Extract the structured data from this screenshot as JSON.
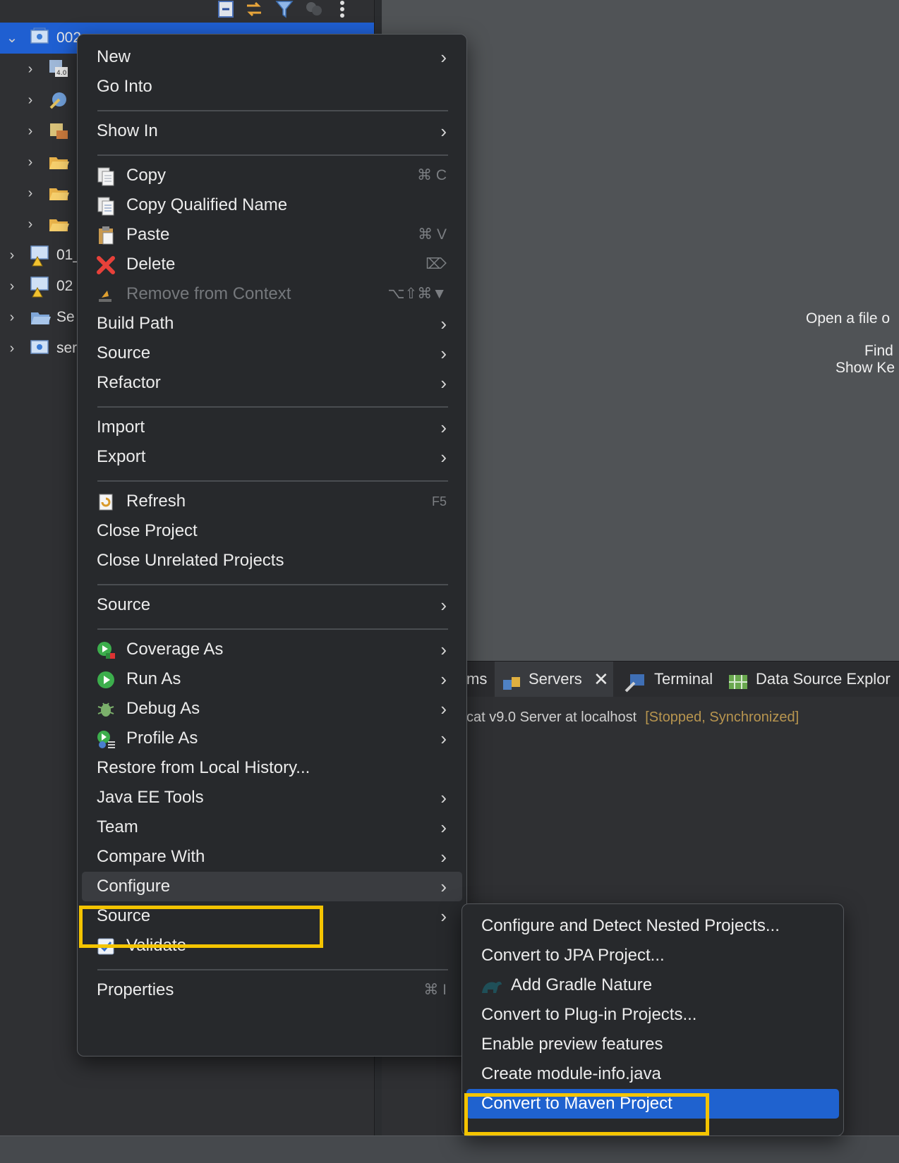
{
  "explorer": {
    "toolbar_icons": [
      "collapse-all-icon",
      "link-with-editor-icon",
      "filter-icon",
      "focus-icon",
      "view-menu-icon"
    ],
    "rows": [
      {
        "label": "002",
        "icon": "web-project-icon",
        "expanded": true,
        "selected": true
      },
      {
        "label": "",
        "icon": "deployment-descriptor-icon"
      },
      {
        "label": "",
        "icon": "jax-ws-icon"
      },
      {
        "label": "",
        "icon": "java-resources-icon"
      },
      {
        "label": "",
        "icon": "folder-icon"
      },
      {
        "label": "",
        "icon": "folder-icon"
      },
      {
        "label": "",
        "icon": "folder-icon"
      },
      {
        "label": "01_",
        "icon": "web-project-warning-icon"
      },
      {
        "label": "02",
        "icon": "web-project-warning-icon"
      },
      {
        "label": "Se",
        "icon": "servers-folder-icon"
      },
      {
        "label": "ser",
        "icon": "web-project-icon"
      }
    ]
  },
  "editor": {
    "hint_open": "Open a file o",
    "hint_find": "Find",
    "hint_keys": "Show Ke"
  },
  "views": {
    "tabs": [
      {
        "label": "ms",
        "icon": ""
      },
      {
        "label": "Servers",
        "icon": "servers-icon",
        "active": true
      },
      {
        "label": "Terminal",
        "icon": "terminal-icon"
      },
      {
        "label": "Data Source Explor",
        "icon": "data-source-icon"
      }
    ],
    "server_name": "cat v9.0 Server at localhost",
    "server_status": "[Stopped, Synchronized]"
  },
  "context_menu": {
    "items": [
      {
        "label": "New",
        "submenu": true
      },
      {
        "label": "Go Into"
      },
      {
        "separator": true
      },
      {
        "label": "Show In",
        "submenu": true
      },
      {
        "separator": true
      },
      {
        "label": "Copy",
        "icon": "copy-icon",
        "shortcut": "⌘ C"
      },
      {
        "label": "Copy Qualified Name",
        "icon": "copy-qualified-name-icon"
      },
      {
        "label": "Paste",
        "icon": "paste-icon",
        "shortcut": "⌘ V"
      },
      {
        "label": "Delete",
        "icon": "delete-icon",
        "shortcut": "⌦"
      },
      {
        "label": "Remove from Context",
        "icon": "remove-context-icon",
        "shortcut": "⌥⇧⌘▼",
        "disabled": true
      },
      {
        "label": "Build Path",
        "submenu": true
      },
      {
        "label": "Source",
        "submenu": true
      },
      {
        "label": "Refactor",
        "submenu": true
      },
      {
        "separator": true
      },
      {
        "label": "Import",
        "submenu": true
      },
      {
        "label": "Export",
        "submenu": true
      },
      {
        "separator": true
      },
      {
        "label": "Refresh",
        "icon": "refresh-icon",
        "shortcut": "F5"
      },
      {
        "label": "Close Project"
      },
      {
        "label": "Close Unrelated Projects"
      },
      {
        "separator": true
      },
      {
        "label": "Source",
        "submenu": true
      },
      {
        "separator": true
      },
      {
        "label": "Coverage As",
        "icon": "coverage-icon",
        "submenu": true
      },
      {
        "label": "Run As",
        "icon": "run-icon",
        "submenu": true
      },
      {
        "label": "Debug As",
        "icon": "debug-icon",
        "submenu": true
      },
      {
        "label": "Profile As",
        "icon": "profile-icon",
        "submenu": true
      },
      {
        "label": "Restore from Local History..."
      },
      {
        "label": "Java EE Tools",
        "submenu": true
      },
      {
        "label": "Team",
        "submenu": true
      },
      {
        "label": "Compare With",
        "submenu": true
      },
      {
        "label": "Configure",
        "submenu": true,
        "hover": true
      },
      {
        "label": "Source",
        "submenu": true
      },
      {
        "label": "Validate",
        "icon": "validate-checkbox-icon"
      },
      {
        "separator": true
      },
      {
        "label": "Properties",
        "shortcut": "⌘ I"
      }
    ]
  },
  "submenu": {
    "items": [
      {
        "label": "Configure and Detect Nested Projects..."
      },
      {
        "label": "Convert to JPA Project..."
      },
      {
        "label": "Add Gradle Nature",
        "icon": "gradle-icon"
      },
      {
        "label": "Convert to Plug-in Projects..."
      },
      {
        "label": "Enable preview features"
      },
      {
        "label": "Create module-info.java"
      },
      {
        "label": "Convert to Maven Project",
        "selected": true
      }
    ]
  },
  "colors": {
    "selection": "#1f62cf",
    "highlight_outline": "#f4c400",
    "server_status": "#b8954f"
  }
}
